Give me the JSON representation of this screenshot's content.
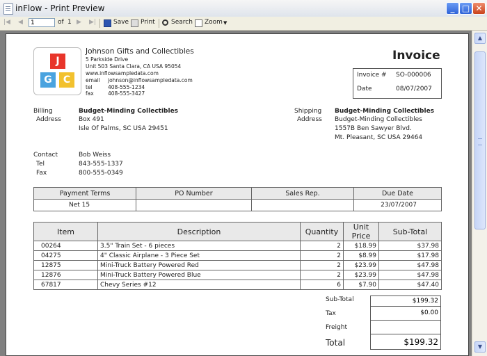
{
  "window": {
    "title": "inFlow - Print Preview"
  },
  "toolbar": {
    "page_value": "1",
    "of_label": "of",
    "page_count": "1",
    "save_label": "Save",
    "print_label": "Print",
    "search_label": "Search",
    "zoom_label": "Zoom"
  },
  "invoice": {
    "title": "Invoice",
    "logo_letters": [
      "J",
      "G",
      "C"
    ],
    "company": {
      "name": "Johnson Gifts and Collectibles",
      "address1": "5 Parkside Drive",
      "address2": "Unit 503 Santa Clara, CA USA 95054",
      "website": "www.inflowsampledata.com",
      "email_label": "email",
      "email": "johnson@inflowsampledata.com",
      "tel_label": "tel",
      "tel": "408-555-1234",
      "fax_label": "fax",
      "fax": "408-555-3427"
    },
    "meta": {
      "invoice_no_label": "Invoice #",
      "invoice_no": "SO-000006",
      "date_label": "Date",
      "date": "08/07/2007"
    },
    "billing": {
      "label1": "Billing",
      "label2": "Address",
      "name": "Budget-Minding Collectibles",
      "line1": "Box 491",
      "line2": "Isle Of Palms, SC  USA  29451"
    },
    "shipping": {
      "label1": "Shipping",
      "label2": "Address",
      "name": "Budget-Minding Collectibles",
      "line1": "Budget-Minding Collectibles",
      "line2": "1557B Ben Sawyer Blvd.",
      "line3": "Mt. Pleasant, SC  USA  29464"
    },
    "contact": {
      "label": "Contact",
      "name": "Bob Weiss",
      "tel_label": "Tel",
      "tel": "843-555-1337",
      "fax_label": "Fax",
      "fax": "800-555-0349"
    },
    "terms_table": {
      "headers": [
        "Payment Terms",
        "PO Number",
        "Sales Rep.",
        "Due Date"
      ],
      "row": [
        "Net 15",
        "",
        "",
        "23/07/2007"
      ]
    },
    "items_table": {
      "headers": [
        "Item",
        "Description",
        "Quantity",
        "Unit Price",
        "Sub-Total"
      ],
      "rows": [
        [
          "00264",
          "3.5\" Train Set - 6 pieces",
          "2",
          "$18.99",
          "$37.98"
        ],
        [
          "04275",
          "4\" Classic Airplane - 3 Piece Set",
          "2",
          "$8.99",
          "$17.98"
        ],
        [
          "12875",
          "Mini-Truck Battery Powered Red",
          "2",
          "$23.99",
          "$47.98"
        ],
        [
          "12876",
          "Mini-Truck Battery Powered Blue",
          "2",
          "$23.99",
          "$47.98"
        ],
        [
          "67817",
          "Chevy Series #12",
          "6",
          "$7.90",
          "$47.40"
        ]
      ]
    },
    "totals": {
      "subtotal_label": "Sub-Total",
      "subtotal": "$199.32",
      "tax_label": "Tax",
      "tax": "$0.00",
      "freight_label": "Freight",
      "freight": "",
      "total_label": "Total",
      "total": "$199.32"
    }
  },
  "colors": {
    "logo_red": "#e8352a",
    "logo_blue": "#4aa3df",
    "logo_yellow": "#f2c12e",
    "titlebar_blue": "#2f63d8"
  }
}
